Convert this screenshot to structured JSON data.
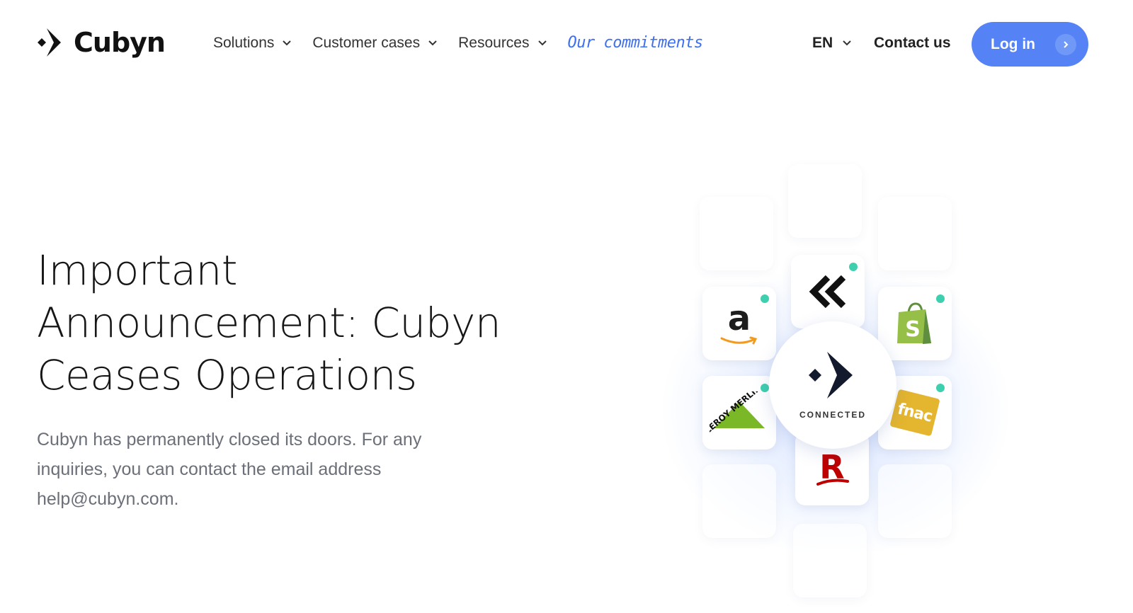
{
  "brand": {
    "name": "Cubyn"
  },
  "nav": {
    "items": [
      {
        "label": "Solutions"
      },
      {
        "label": "Customer cases"
      },
      {
        "label": "Resources"
      }
    ],
    "commitments": "Our commitments"
  },
  "header": {
    "language": "EN",
    "contact": "Contact us",
    "login": "Log in"
  },
  "hero": {
    "title_lines": [
      "Important",
      "Announcement: Cubyn",
      "Ceases Operations"
    ],
    "body": "Cubyn has permanently closed its doors. For any inquiries, you can contact the email address help@cubyn.com."
  },
  "illustration": {
    "hub_label": "CONNECTED",
    "partner_logos": [
      "amazon",
      "kickstarter-chevrons",
      "shopify",
      "leroy-merlin",
      "fnac",
      "rakuten"
    ],
    "fnac_text": "fnac",
    "amazon_text": "a",
    "shopify_text": "S",
    "rakuten_text": "R",
    "leroy_text": "LEROY MERLIN"
  },
  "colors": {
    "accent": "#5583f5",
    "status_dot": "#3ecfae",
    "commitments": "#3d6ff0"
  }
}
